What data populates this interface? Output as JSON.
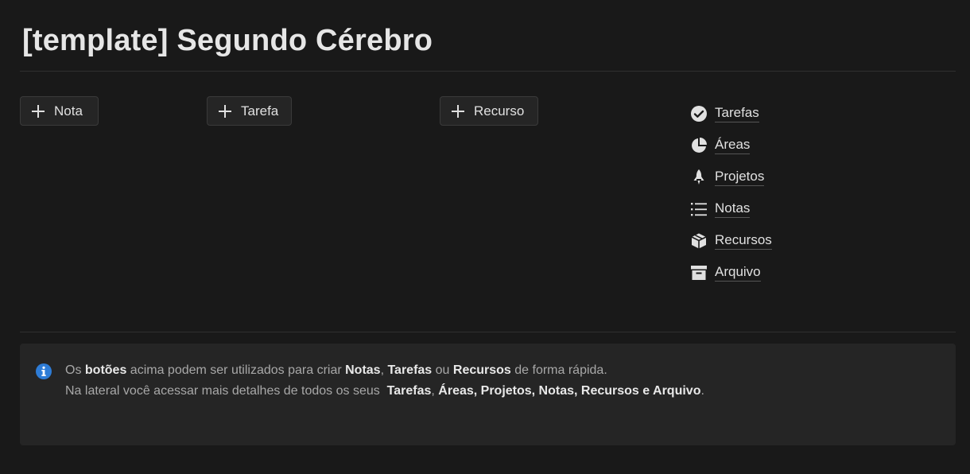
{
  "page": {
    "title": "[template] Segundo Cérebro"
  },
  "buttons": {
    "nota": "Nota",
    "tarefa": "Tarefa",
    "recurso": "Recurso"
  },
  "nav": {
    "items": [
      {
        "label": "Tarefas",
        "icon": "check-circle-icon"
      },
      {
        "label": "Áreas",
        "icon": "pie-chart-icon"
      },
      {
        "label": "Projetos",
        "icon": "rocket-icon"
      },
      {
        "label": "Notas",
        "icon": "list-icon"
      },
      {
        "label": "Recursos",
        "icon": "box-icon"
      },
      {
        "label": "Arquivo",
        "icon": "archive-icon"
      }
    ]
  },
  "callout": {
    "icon": "info-icon",
    "line1": {
      "t1": "Os ",
      "b1": "botões",
      "t2": " acima podem ser utilizados para criar ",
      "b2": "Notas",
      "t3": ", ",
      "b3": "Tarefas",
      "t4": " ou ",
      "b4": "Recursos",
      "t5": " de forma rápida."
    },
    "line2": {
      "t1": "Na lateral você acessar mais detalhes de todos os seus  ",
      "b1": "Tarefas",
      "t2": ", ",
      "b2": "Áreas, Projetos, Notas, Recursos e Arquivo",
      "t3": "."
    }
  },
  "colors": {
    "background": "#191919",
    "callout_bg": "#252525",
    "info_blue": "#2e7cd6"
  }
}
